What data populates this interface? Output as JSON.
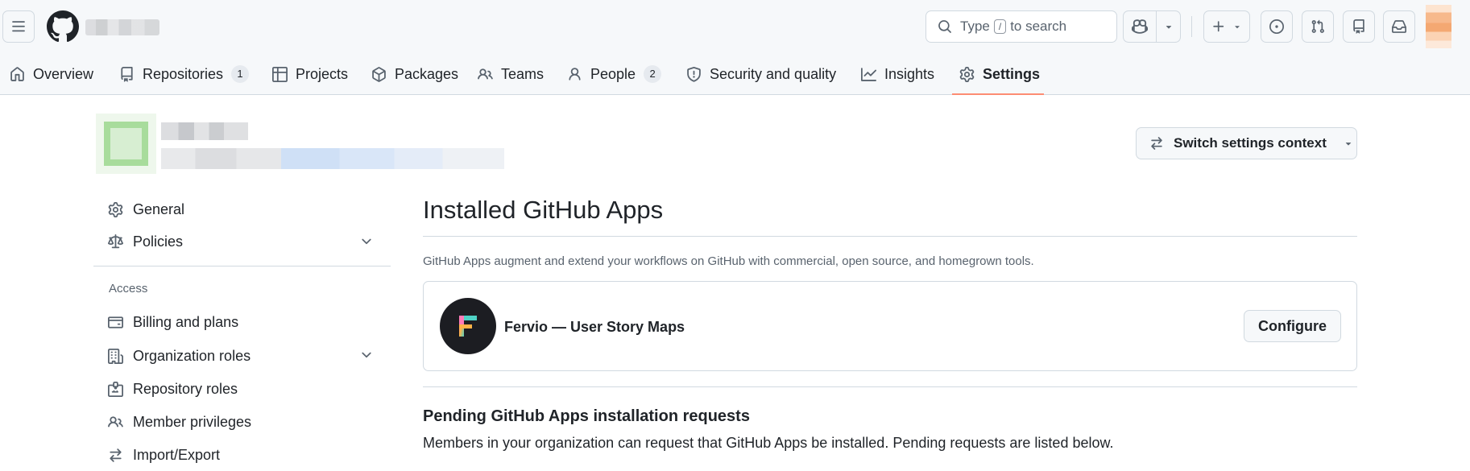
{
  "header": {
    "search_prefix": "Type",
    "search_key": "/",
    "search_suffix": "to search",
    "icons": [
      "hamburger-icon",
      "github-logo-icon",
      "search-icon",
      "copilot-icon",
      "plus-icon",
      "issues-icon",
      "pull-request-icon",
      "repo-icon",
      "inbox-icon"
    ]
  },
  "nav": {
    "tabs": [
      {
        "label": "Overview"
      },
      {
        "label": "Repositories",
        "count": "1"
      },
      {
        "label": "Projects"
      },
      {
        "label": "Packages"
      },
      {
        "label": "Teams"
      },
      {
        "label": "People",
        "count": "2"
      },
      {
        "label": "Security and quality"
      },
      {
        "label": "Insights"
      },
      {
        "label": "Settings",
        "active": true
      }
    ],
    "active_underline_color": "#fd8c73"
  },
  "context": {
    "switch_label": "Switch settings context"
  },
  "sidebar": {
    "items": [
      {
        "label": "General"
      },
      {
        "label": "Policies"
      },
      {
        "label": "Billing and plans"
      },
      {
        "label": "Organization roles"
      },
      {
        "label": "Repository roles"
      },
      {
        "label": "Member privileges"
      },
      {
        "label": "Import/Export"
      }
    ],
    "access_heading": "Access"
  },
  "main": {
    "title": "Installed GitHub Apps",
    "description": "GitHub Apps augment and extend your workflows on GitHub with commercial, open source, and homegrown tools.",
    "app": {
      "logo_letter": "F",
      "name": "Fervio — User Story Maps",
      "configure_label": "Configure"
    },
    "pending": {
      "title": "Pending GitHub Apps installation requests",
      "description": "Members in your organization can request that GitHub Apps be installed. Pending requests are listed below."
    }
  }
}
